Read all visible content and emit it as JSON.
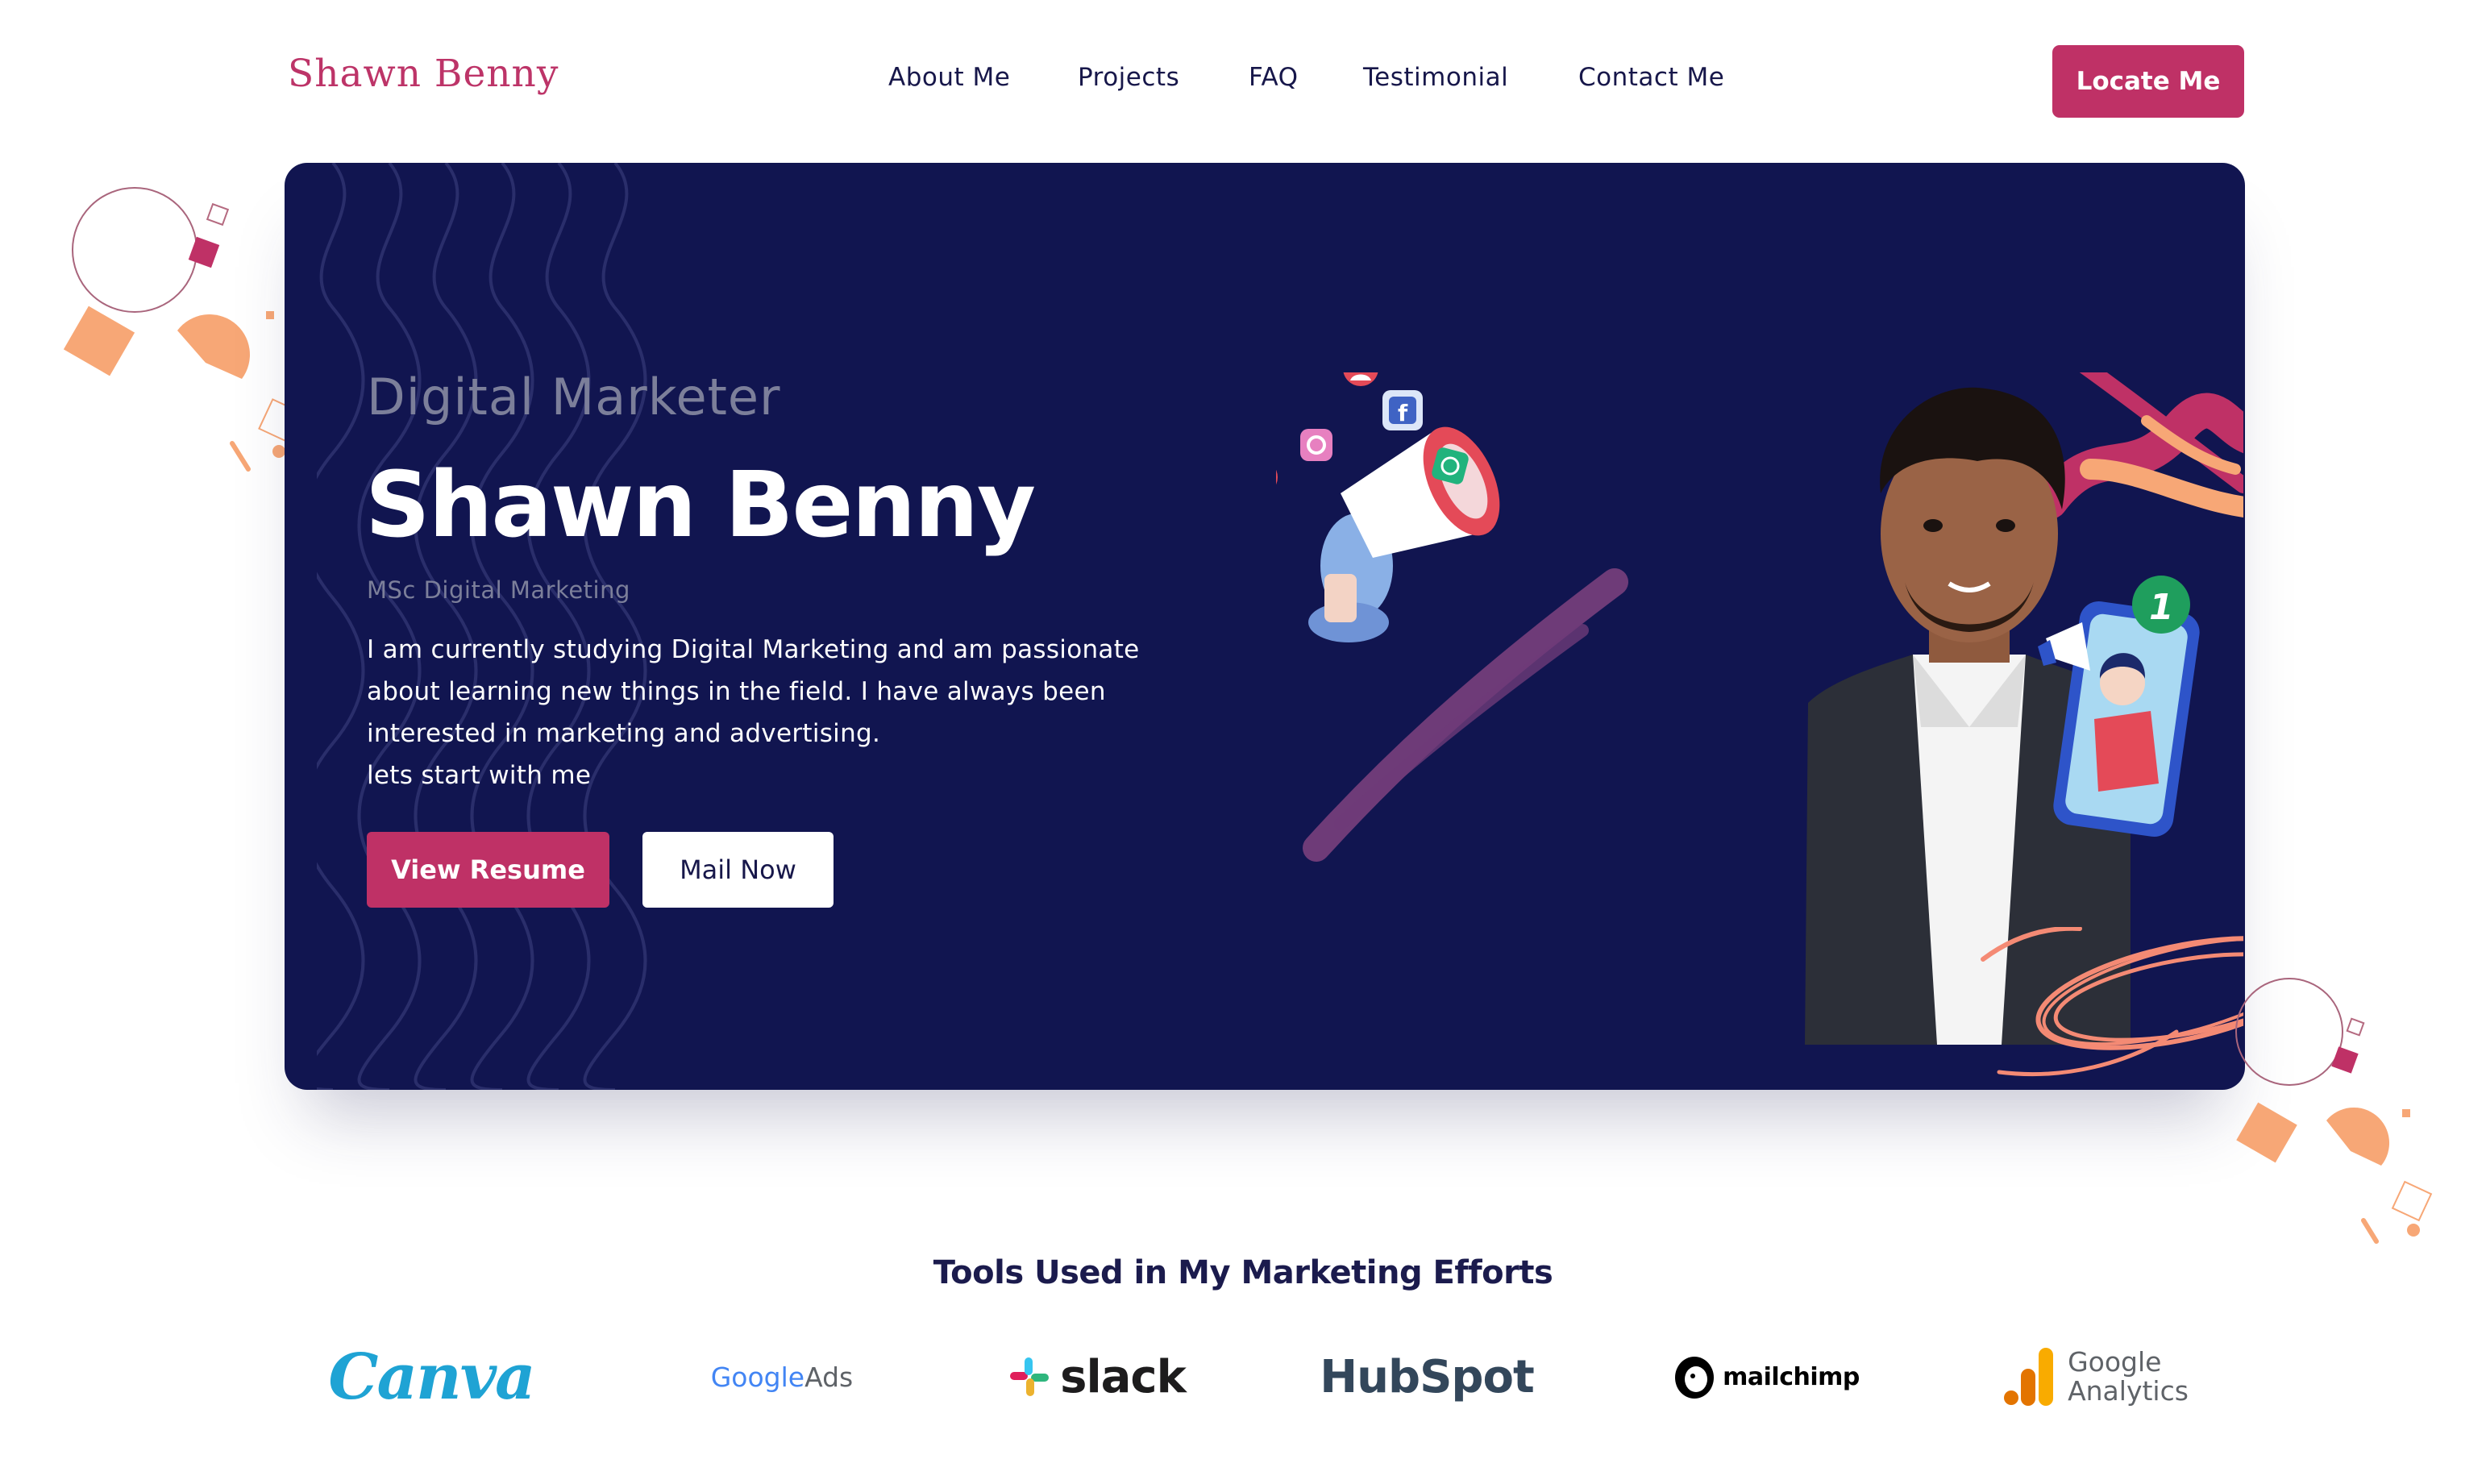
{
  "header": {
    "logo": "Shawn Benny",
    "nav": [
      "About Me",
      "Projects",
      "FAQ",
      "Testimonial",
      "Contact Me"
    ],
    "cta_label": "Locate Me"
  },
  "hero": {
    "subtitle": "Digital Marketer",
    "name": "Shawn Benny",
    "degree": "MSc Digital Marketing",
    "bio_lines": [
      "I am currently studying Digital Marketing and am passionate",
      "about learning new things in the field. I have always been",
      "interested in marketing and advertising.",
      "lets start with me"
    ],
    "primary_button": "View Resume",
    "secondary_button": "Mail Now"
  },
  "tools": {
    "heading": "Tools Used in My Marketing Efforts",
    "logos": [
      {
        "name": "Canva",
        "text": "Canva"
      },
      {
        "name": "Google Ads",
        "text_a": "Google",
        "text_b": " Ads"
      },
      {
        "name": "Slack",
        "text": "slack"
      },
      {
        "name": "HubSpot",
        "text": "HubSpot"
      },
      {
        "name": "Mailchimp",
        "text": "mailchimp"
      },
      {
        "name": "Google Analytics",
        "text_a": "Google",
        "text_b": "Analytics"
      }
    ]
  },
  "colors": {
    "brand": "#bf3166",
    "hero_bg": "#111550",
    "accent_peach": "#f7a776",
    "text_dark": "#17174a"
  },
  "icons": [
    "megaphone-icon",
    "facebook-icon",
    "instagram-icon",
    "whatsapp-icon",
    "heart-icon",
    "notification-badge-icon"
  ]
}
